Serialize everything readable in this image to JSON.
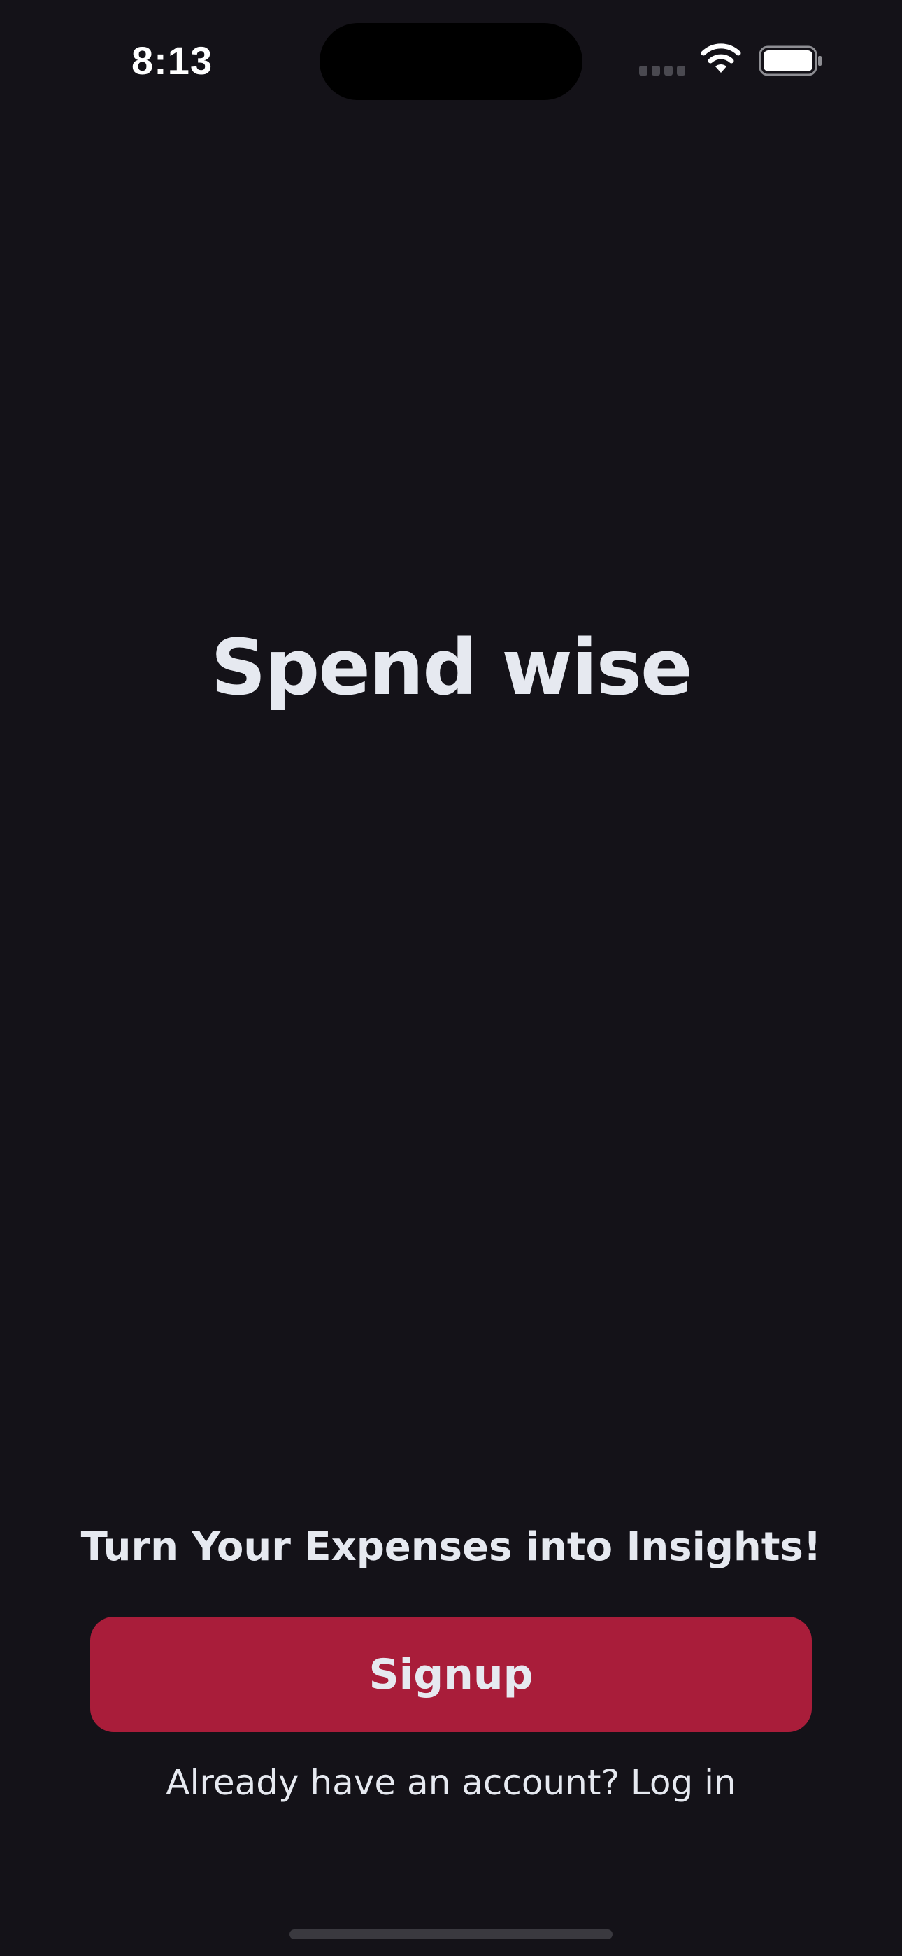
{
  "status_bar": {
    "time": "8:13",
    "icons": [
      "cellular-signal-icon",
      "wifi-icon",
      "battery-icon"
    ]
  },
  "main": {
    "title": "Spend wise",
    "tagline": "Turn Your Expenses into Insights!",
    "signup_label": "Signup",
    "login_prompt": "Already have an account?",
    "login_link": "Log in"
  },
  "colors": {
    "background": "#141218",
    "accent": "#A91D3A",
    "text": "#E6E9F0"
  }
}
